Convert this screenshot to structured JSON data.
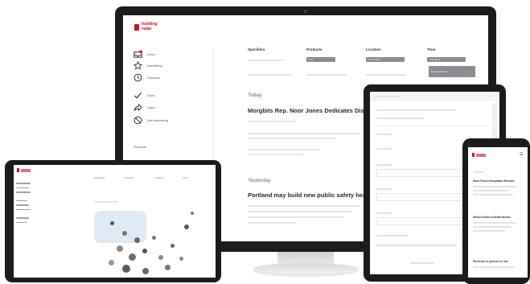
{
  "brand": {
    "line1": "building",
    "line2": "radar",
    "color": "#c8102e"
  },
  "desktop": {
    "nav": [
      {
        "label": "Inbox",
        "icon": "inbox-icon"
      },
      {
        "label": "Interesting",
        "icon": "star-icon"
      },
      {
        "label": "Snoozed",
        "icon": "clock-icon"
      },
      {
        "label": "Done",
        "icon": "check-icon"
      },
      {
        "label": "Liked",
        "icon": "share-icon"
      },
      {
        "label": "Not interesting",
        "icon": "block-icon"
      }
    ],
    "nav_footer": "Products",
    "filters": [
      {
        "heading": "Specifiers",
        "chip": ""
      },
      {
        "heading": "Products",
        "chip": "Any"
      },
      {
        "heading": "Location",
        "chip": "All in State"
      },
      {
        "heading": "Time",
        "chip": "This week"
      }
    ],
    "extra_chip": "Snoozed items",
    "sections": [
      {
        "day": "Today",
        "headline": "Morgbits Rep. Noor Jones Dedicates District"
      },
      {
        "day": "Yesterday",
        "headline": "Portland may build new public safety headquarters"
      }
    ]
  },
  "tablet": {
    "lines": 10
  },
  "phone": {
    "headlines": [
      "Moon Rocket Hospitality Remains",
      "Wilson Downs to Build Houses",
      "Rochester in planned 12 unit"
    ]
  },
  "ipad": {
    "columns": [
      "Specifiers",
      "Products",
      "Location",
      "Time"
    ]
  }
}
